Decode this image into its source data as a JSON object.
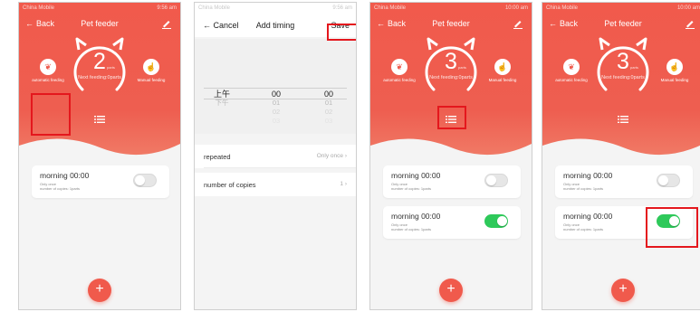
{
  "status_bar": {
    "carrier": "China Mobile",
    "times": [
      "9:56 am",
      "9:56 am",
      "10:00 am",
      "10:00 am"
    ]
  },
  "main_screen": {
    "back_label": "Back",
    "title": "Pet feeder",
    "dial_unit": "parts",
    "dial_subtitle": "Next feeding:0parts",
    "auto_label": "automatic feeding",
    "manual_label": "Manual feeding",
    "fab_label": "+"
  },
  "screens": [
    {
      "count": "2",
      "schedules": [
        {
          "time": "morning 00:00",
          "repeat": "Only once",
          "copies": "number of copies: 1parts",
          "enabled": false
        }
      ]
    },
    {
      "count": "3",
      "schedules": [
        {
          "time": "morning 00:00",
          "repeat": "Only once",
          "copies": "number of copies: 1parts",
          "enabled": false
        },
        {
          "time": "morning 00:00",
          "repeat": "Only once",
          "copies": "number of copies: 1parts",
          "enabled": true
        }
      ]
    },
    {
      "count": "3",
      "schedules": [
        {
          "time": "morning 00:00",
          "repeat": "Only once",
          "copies": "number of copies: 1parts",
          "enabled": false
        },
        {
          "time": "morning 00:00",
          "repeat": "Only once",
          "copies": "number of copies: 1parts",
          "enabled": true
        }
      ]
    }
  ],
  "add_timing": {
    "cancel_label": "Cancel",
    "title": "Add timing",
    "save_label": "Save",
    "picker": {
      "period": {
        "selected": "上午",
        "below": [
          "下午"
        ]
      },
      "hour": {
        "selected": "00",
        "below": [
          "01",
          "02",
          "03"
        ]
      },
      "minute": {
        "selected": "00",
        "below": [
          "01",
          "02",
          "03"
        ]
      }
    },
    "repeated_label": "repeated",
    "repeated_value": "Only once",
    "copies_label": "number of copies",
    "copies_value": "1"
  },
  "colors": {
    "accent": "#f05a4c",
    "toggle_on": "#2ec95a",
    "highlight": "#e4171d"
  }
}
